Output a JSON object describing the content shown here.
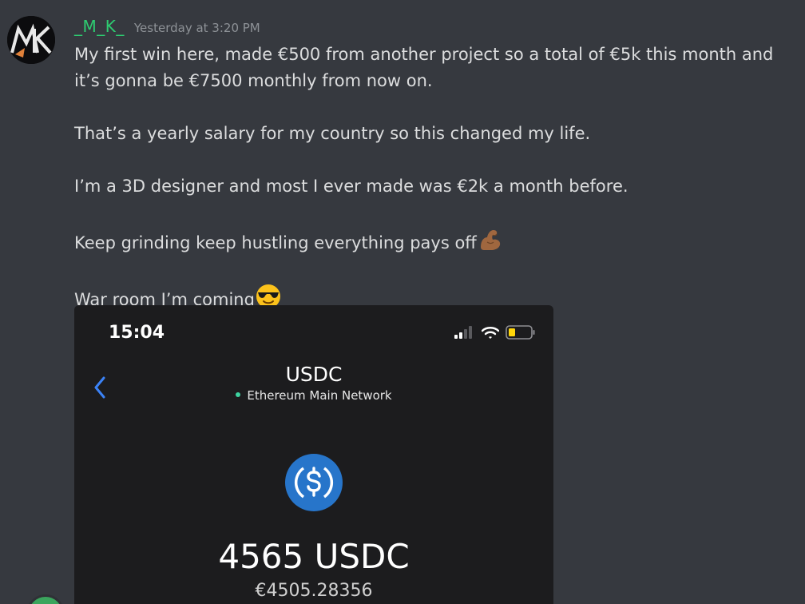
{
  "message": {
    "username": "_M_K_",
    "timestamp": "Yesterday at 3:20 PM",
    "avatar_icon": "mk-monogram-avatar",
    "lines": [
      "My first win here, made €500 from another project so a total of €5k this month and it’s gonna be €7500 monthly from now on.",
      "That’s a yearly salary for my country so this changed my life.",
      "I’m a 3D designer and most I ever made was €2k a month before.",
      "Keep grinding keep hustling everything pays off",
      "War room I’m coming"
    ],
    "emojis": {
      "line4": "flexed-biceps-emoji",
      "line5": "sunglasses-face-emoji"
    }
  },
  "attachment": {
    "status_bar": {
      "time": "15:04",
      "icons": [
        "cellular-signal-icon",
        "wifi-icon",
        "battery-icon"
      ]
    },
    "back_icon": "chevron-left-icon",
    "asset_name": "USDC",
    "network": "Ethereum Main Network",
    "logo_icon": "usdc-logo-icon",
    "balance": "4565 USDC",
    "fiat_value": "€4505.28356"
  },
  "colors": {
    "background": "#36393f",
    "username": "#2ecc71",
    "timestamp": "#8e9297",
    "text": "#dcddde",
    "phone_bg": "#1c1c1e",
    "usdc_blue": "#2775ca",
    "network_dot": "#3dd3a0"
  }
}
